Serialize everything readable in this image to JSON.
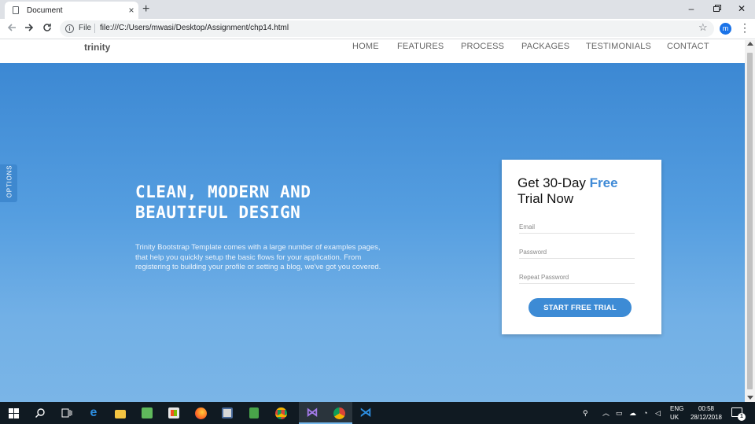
{
  "browser": {
    "tab_title": "Document",
    "tab_close": "×",
    "new_tab": "+",
    "scheme_label": "File",
    "url": "file:///C:/Users/mwasi/Desktop/Assignment/chp14.html",
    "profile_initial": "m",
    "window_controls": {
      "minimize": "–",
      "close": "✕"
    }
  },
  "site": {
    "brand": "trinity",
    "menu": [
      "HOME",
      "FEATURES",
      "PROCESS",
      "PACKAGES",
      "TESTIMONIALS",
      "CONTACT"
    ],
    "options_label": "OPTIONS",
    "hero": {
      "title_line1": "CLEAN, MODERN AND",
      "title_line2": "BEAUTIFUL DESIGN",
      "description": "Trinity Bootstrap Template comes with a large number of examples pages, that help you quickly setup the basic flows for your application. From registering to building your profile or setting a blog, we've got you covered."
    },
    "form": {
      "title_prefix": "Get 30-Day ",
      "title_highlight": "Free",
      "title_suffix": "Trial Now",
      "email_placeholder": "Email",
      "password_placeholder": "Password",
      "repeat_placeholder": "Repeat Password",
      "submit_label": "START FREE TRIAL"
    }
  },
  "taskbar": {
    "apps": [
      "start-icon",
      "search-icon",
      "task-view-icon",
      "edge-icon",
      "file-explorer-icon",
      "photos-icon",
      "store-icon",
      "firefox-icon",
      "media-app-icon",
      "notepad-icon",
      "chrome-icon",
      "visual-studio-icon",
      "chrome-active-icon",
      "vscode-icon"
    ],
    "language": "ENG",
    "region": "UK",
    "time": "00:58",
    "date": "28/12/2018",
    "notification_count": "1"
  },
  "colors": {
    "accent": "#3d8bd5",
    "hero_top": "#3c88d3",
    "hero_bottom": "#7ab5e7",
    "taskbar": "#101a22"
  }
}
